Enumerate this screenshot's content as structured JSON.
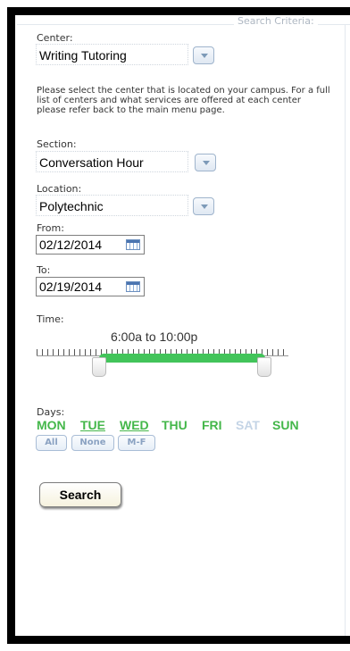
{
  "fieldset": {
    "legend": "Search Criteria:"
  },
  "center": {
    "label": "Center:",
    "value": "Writing Tutoring"
  },
  "help_text": "Please select the center that is located on your campus. For a full list of centers and what services are offered at each center please refer back to the main menu page.",
  "section": {
    "label": "Section:",
    "value": "Conversation Hour"
  },
  "location": {
    "label": "Location:",
    "value": "Polytechnic"
  },
  "from": {
    "label": "From:",
    "value": "02/12/2014"
  },
  "to": {
    "label": "To:",
    "value": "02/19/2014"
  },
  "time": {
    "label": "Time:",
    "range_text": "6:00a to 10:00p",
    "range_start_fraction": 0.25,
    "range_end_fraction": 0.917
  },
  "days": {
    "label": "Days:",
    "items": [
      {
        "label": "MON",
        "selected": true
      },
      {
        "label": "TUE",
        "selected": true
      },
      {
        "label": "WED",
        "selected": true
      },
      {
        "label": "THU",
        "selected": true
      },
      {
        "label": "FRI",
        "selected": true
      },
      {
        "label": "SAT",
        "selected": false
      },
      {
        "label": "SUN",
        "selected": true
      }
    ],
    "quick_buttons": [
      "All",
      "None",
      "M-F"
    ]
  },
  "search_button": "Search",
  "colors": {
    "selected_day": "#44b74a",
    "unselected_day": "#c4d4e6",
    "slider_range": "#42c45a"
  }
}
